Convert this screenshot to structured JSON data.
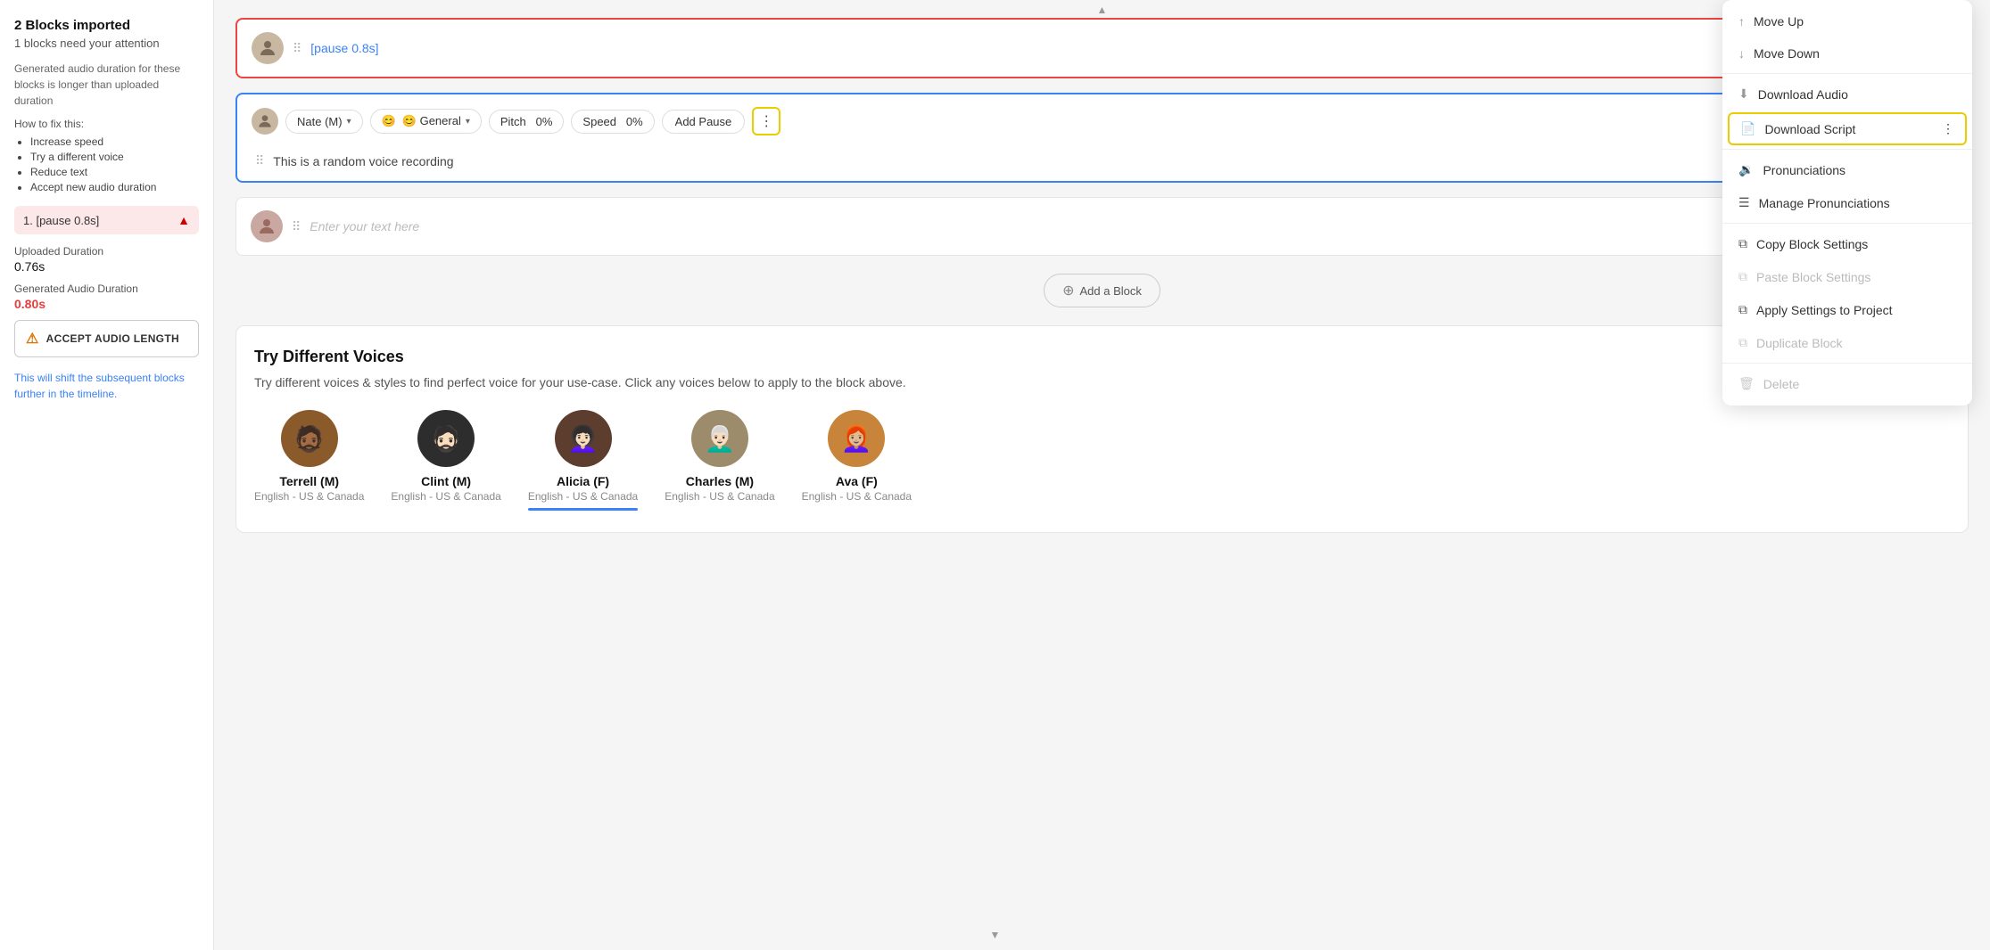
{
  "sidebar": {
    "title": "2 Blocks imported",
    "subtitle": "1 blocks need your attention",
    "description": "Generated audio duration for these blocks is longer than uploaded duration",
    "how_to_fix": "How to fix this:",
    "fixes": [
      "Increase speed",
      "Try a different voice",
      "Reduce text",
      "Accept new audio duration"
    ],
    "block_item": {
      "label": "1. [pause 0.8s]",
      "uploaded_duration_label": "Uploaded Duration",
      "uploaded_duration_value": "0.76s",
      "generated_label": "Generated Audio Duration",
      "generated_value": "0.80s"
    },
    "accept_btn_label": "ACCEPT AUDIO LENGTH",
    "shift_text": "This will shift the subsequent blocks further in the timeline."
  },
  "main": {
    "block1": {
      "text": "[pause 0.8s]"
    },
    "block2": {
      "voice": "Nate (M)",
      "emotion": "😊 General",
      "pitch_label": "Pitch",
      "pitch_value": "0%",
      "speed_label": "Speed",
      "speed_value": "0%",
      "add_pause": "Add Pause",
      "text": "This is a random voice recording"
    },
    "block3": {
      "placeholder": "Enter your text here"
    },
    "add_block_btn": "Add a Block",
    "voices_panel": {
      "title": "Try Different Voices",
      "description": "Try different voices & styles to find perfect voice for your use-case. Click any voices below to apply to the block above.",
      "voices": [
        {
          "name": "Terrell (M)",
          "lang": "English - US & Canada",
          "color": "#8B5A2B"
        },
        {
          "name": "Clint (M)",
          "lang": "English - US & Canada",
          "color": "#2d2d2d"
        },
        {
          "name": "Alicia (F)",
          "lang": "English - US & Canada",
          "color": "#5c3d2e"
        },
        {
          "name": "Charles (M)",
          "lang": "English - US & Canada",
          "color": "#9c8c6c"
        },
        {
          "name": "Ava (F)",
          "lang": "English - US & Canada",
          "color": "#c8843a"
        }
      ]
    }
  },
  "context_menu": {
    "items": [
      {
        "id": "move-up",
        "label": "Move Up",
        "icon": "↑",
        "disabled": false
      },
      {
        "id": "move-down",
        "label": "Move Down",
        "icon": "↓",
        "disabled": false
      },
      {
        "id": "download-audio",
        "label": "Download Audio",
        "icon": "⬇",
        "disabled": false
      },
      {
        "id": "download-script",
        "label": "Download Script",
        "icon": "📄",
        "disabled": false,
        "highlighted": true
      },
      {
        "id": "pronunciations",
        "label": "Pronunciations",
        "icon": "🔊",
        "disabled": false
      },
      {
        "id": "manage-pronunciations",
        "label": "Manage Pronunciations",
        "icon": "☰",
        "disabled": false
      },
      {
        "id": "copy-block-settings",
        "label": "Copy Block Settings",
        "icon": "⧉",
        "disabled": false
      },
      {
        "id": "paste-block-settings",
        "label": "Paste Block Settings",
        "icon": "⧉",
        "disabled": true
      },
      {
        "id": "apply-settings",
        "label": "Apply Settings to Project",
        "icon": "⧉",
        "disabled": false
      },
      {
        "id": "duplicate-block",
        "label": "Duplicate Block",
        "icon": "⧉",
        "disabled": true
      },
      {
        "id": "delete",
        "label": "Delete",
        "icon": "🗑",
        "disabled": true
      }
    ]
  }
}
